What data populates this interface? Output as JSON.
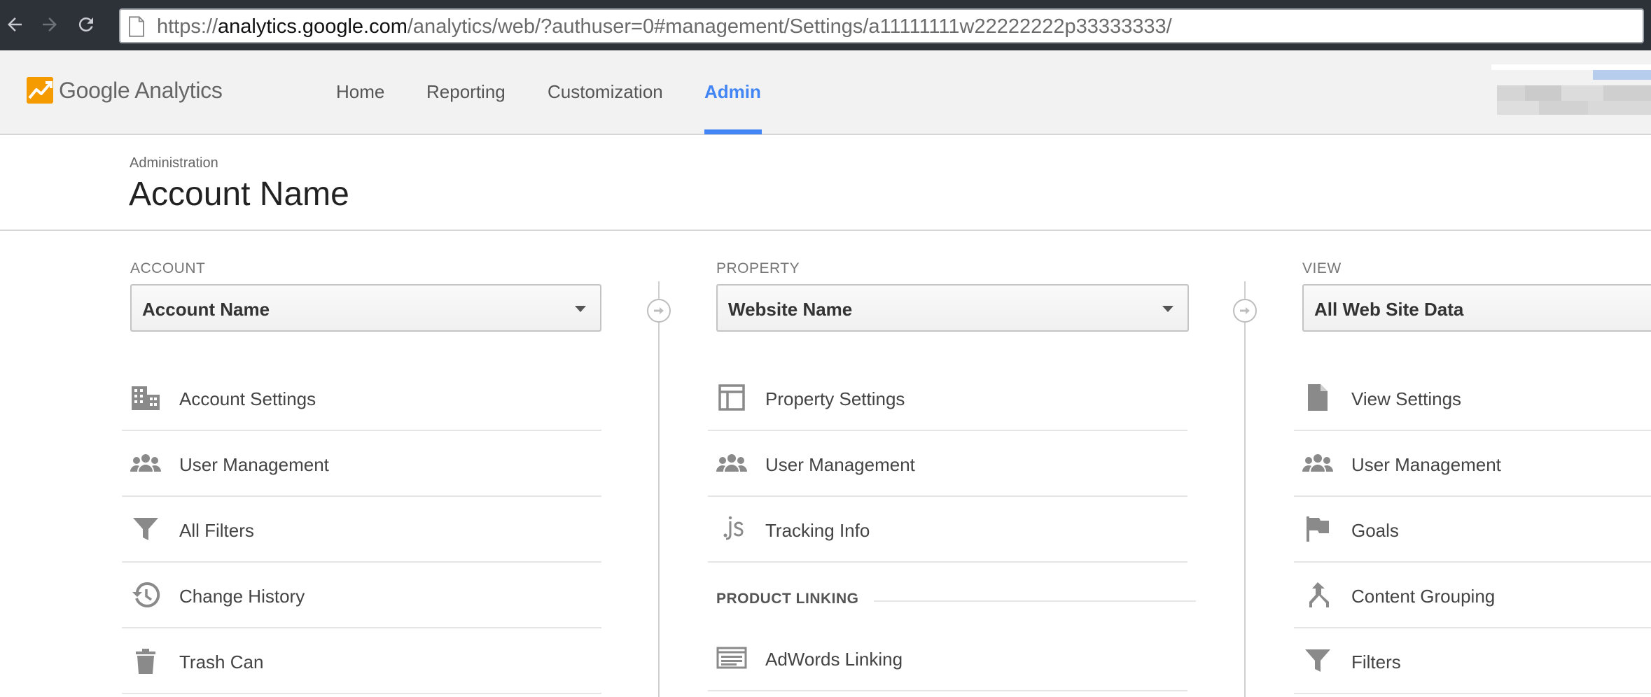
{
  "browser": {
    "url_prefix": "https://",
    "url_host": "analytics.google.com",
    "url_path": "/analytics/web/?authuser=0#management/Settings/a11111111w22222222p33333333/"
  },
  "app": {
    "name": "Google Analytics",
    "accent_color": "#4285f4",
    "logo_colors": [
      "#f4b400",
      "#f57c00"
    ]
  },
  "topnav": {
    "tabs": [
      {
        "label": "Home",
        "active": false
      },
      {
        "label": "Reporting",
        "active": false
      },
      {
        "label": "Customization",
        "active": false
      },
      {
        "label": "Admin",
        "active": true
      }
    ]
  },
  "page": {
    "breadcrumb": "Administration",
    "title": "Account Name"
  },
  "account": {
    "label": "ACCOUNT",
    "selected": "Account Name",
    "items": [
      {
        "label": "Account Settings",
        "icon": "building-icon"
      },
      {
        "label": "User Management",
        "icon": "users-icon"
      },
      {
        "label": "All Filters",
        "icon": "filter-icon"
      },
      {
        "label": "Change History",
        "icon": "history-icon"
      },
      {
        "label": "Trash Can",
        "icon": "trash-icon"
      }
    ]
  },
  "property": {
    "label": "PROPERTY",
    "selected": "Website Name",
    "items": [
      {
        "label": "Property Settings",
        "icon": "layout-icon"
      },
      {
        "label": "User Management",
        "icon": "users-icon"
      },
      {
        "label": "Tracking Info",
        "icon": "js-icon"
      }
    ],
    "section_heading": "PRODUCT LINKING",
    "linking_items": [
      {
        "label": "AdWords Linking",
        "icon": "adwords-icon"
      }
    ]
  },
  "view": {
    "label": "VIEW",
    "selected": "All Web Site Data",
    "items": [
      {
        "label": "View Settings",
        "icon": "document-icon"
      },
      {
        "label": "User Management",
        "icon": "users-icon"
      },
      {
        "label": "Goals",
        "icon": "flag-icon"
      },
      {
        "label": "Content Grouping",
        "icon": "grouping-icon"
      },
      {
        "label": "Filters",
        "icon": "filter-icon"
      }
    ]
  }
}
